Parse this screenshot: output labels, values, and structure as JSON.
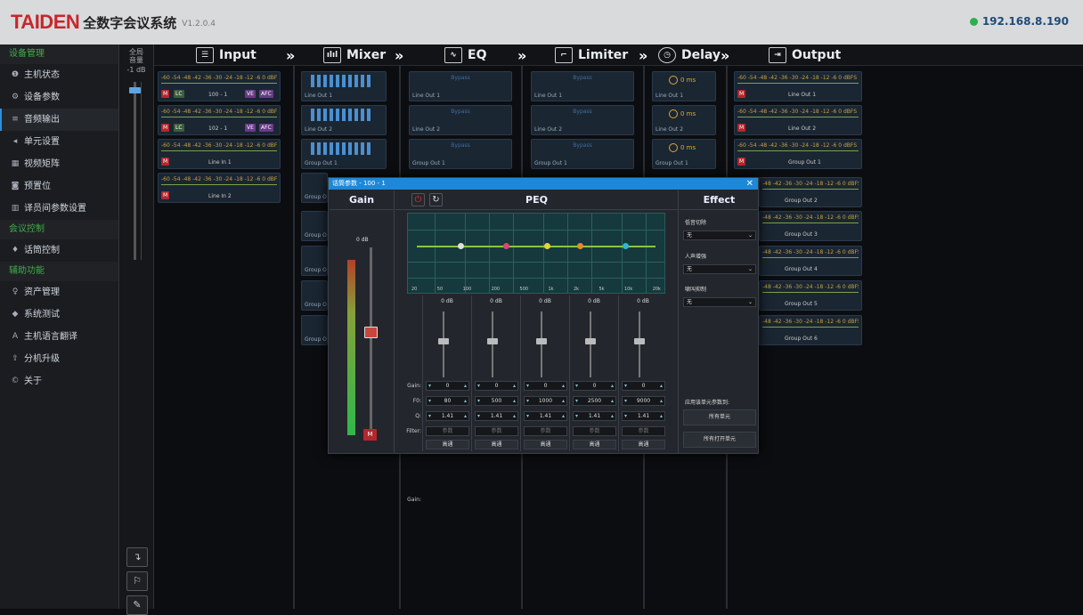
{
  "header": {
    "brand": "TAIDEN",
    "brand_sub": "全数字会议系统",
    "version": "V1.2.0.4",
    "ip": "192.168.8.190"
  },
  "sidebar": {
    "heads": [
      "设备管理",
      "会议控制",
      "辅助功能"
    ],
    "items": [
      {
        "label": "主机状态",
        "icon": "info-icon"
      },
      {
        "label": "设备参数",
        "icon": "gears-icon"
      },
      {
        "label": "音频输出",
        "icon": "sliders-icon"
      },
      {
        "label": "单元设置",
        "icon": "speaker-icon"
      },
      {
        "label": "视频矩阵",
        "icon": "grid-icon"
      },
      {
        "label": "预置位",
        "icon": "camera-icon"
      },
      {
        "label": "译员间参数设置",
        "icon": "booth-icon"
      },
      {
        "label": "话筒控制",
        "icon": "mic-icon"
      },
      {
        "label": "资产管理",
        "icon": "pin-icon"
      },
      {
        "label": "系统测试",
        "icon": "test-icon"
      },
      {
        "label": "主机语言翻译",
        "icon": "translate-icon"
      },
      {
        "label": "分机升级",
        "icon": "upload-icon"
      },
      {
        "label": "关于",
        "icon": "copyright-icon"
      }
    ]
  },
  "master": {
    "label_line1": "全局",
    "label_line2": "音量",
    "db": "-1 dB"
  },
  "stages": {
    "input": "Input",
    "mixer": "Mixer",
    "eq": "EQ",
    "limiter": "Limiter",
    "delay": "Delay",
    "output": "Output"
  },
  "meter_scale": "-60 -54 -48 -42 -36 -30 -24 -18 -12 -6 0 dBFS",
  "meter_scale_short": "-48 -42 -36 -30 -24 -18 -12 -6 0 dBFS",
  "inputs": [
    {
      "name": "100 - 1",
      "tags": [
        "M",
        "LC",
        "VE",
        "AFC"
      ]
    },
    {
      "name": "102 - 1",
      "tags": [
        "M",
        "LC",
        "VE",
        "AFC"
      ]
    },
    {
      "name": "Line In 1",
      "tags": [
        "M"
      ]
    },
    {
      "name": "Line In 2",
      "tags": [
        "M"
      ]
    }
  ],
  "mixer_rows": [
    "Line Out 1",
    "Line Out 2",
    "Group Out 1",
    "Group O",
    "Group O",
    "Group O",
    "Group O",
    "Group O"
  ],
  "eq_rows": [
    {
      "name": "Line Out 1",
      "state": "Bypass"
    },
    {
      "name": "Line Out 2",
      "state": "Bypass"
    },
    {
      "name": "Group Out 1",
      "state": "Bypass"
    }
  ],
  "limiter_rows": [
    {
      "name": "Line Out 1",
      "state": "Bypass"
    },
    {
      "name": "Line Out 2",
      "state": "Bypass"
    },
    {
      "name": "Group Out 1",
      "state": "Bypass"
    }
  ],
  "delay_rows": [
    {
      "name": "Line Out 1",
      "value": "0 ms"
    },
    {
      "name": "Line Out 2",
      "value": "0 ms"
    },
    {
      "name": "Group Out 1",
      "value": "0 ms"
    }
  ],
  "outputs": [
    "Line Out 1",
    "Line Out 2",
    "Group Out 1",
    "Group Out 2",
    "Group Out 3",
    "Group Out 4",
    "Group Out 5",
    "Group Out 6"
  ],
  "dialog": {
    "title": "话筒参数 - 100 - 1",
    "gain": {
      "title": "Gain",
      "db": "0 dB",
      "mute": "M"
    },
    "peq": {
      "title": "PEQ",
      "freq_labels": [
        "20",
        "50",
        "100",
        "200",
        "500",
        "1k",
        "2k",
        "5k",
        "10k",
        "20k"
      ],
      "row_labels": {
        "gain": "Gain:",
        "f0": "F0:",
        "q": "Q:",
        "filter": "Filter:"
      },
      "bands": [
        {
          "db": "0 dB",
          "gain": "0",
          "f0": "80",
          "q": "1.41",
          "filter": "参数",
          "type": "高通",
          "color": "#e0e0e0"
        },
        {
          "db": "0 dB",
          "gain": "0",
          "f0": "500",
          "q": "1.41",
          "filter": "参数",
          "type": "高通",
          "color": "#d9457a"
        },
        {
          "db": "0 dB",
          "gain": "0",
          "f0": "1000",
          "q": "1.41",
          "filter": "参数",
          "type": "高通",
          "color": "#e6d23a"
        },
        {
          "db": "0 dB",
          "gain": "0",
          "f0": "2500",
          "q": "1.41",
          "filter": "参数",
          "type": "高通",
          "color": "#e58a2e"
        },
        {
          "db": "0 dB",
          "gain": "0",
          "f0": "9000",
          "q": "1.41",
          "filter": "参数",
          "type": "高通",
          "color": "#2fb6d8"
        }
      ]
    },
    "effect": {
      "title": "Effect",
      "low_cut_label": "低音切除",
      "low_cut_value": "无",
      "voice_label": "人声增强",
      "voice_value": "无",
      "feedback_label": "啸叫抑制",
      "feedback_value": "无",
      "apply_label": "应用该单元参数到:",
      "all_units": "所有单元",
      "all_open_units": "所有打开单元"
    }
  },
  "bottom_buttons": [
    "down-arrow-icon",
    "flag-icon",
    "wrench-icon"
  ]
}
